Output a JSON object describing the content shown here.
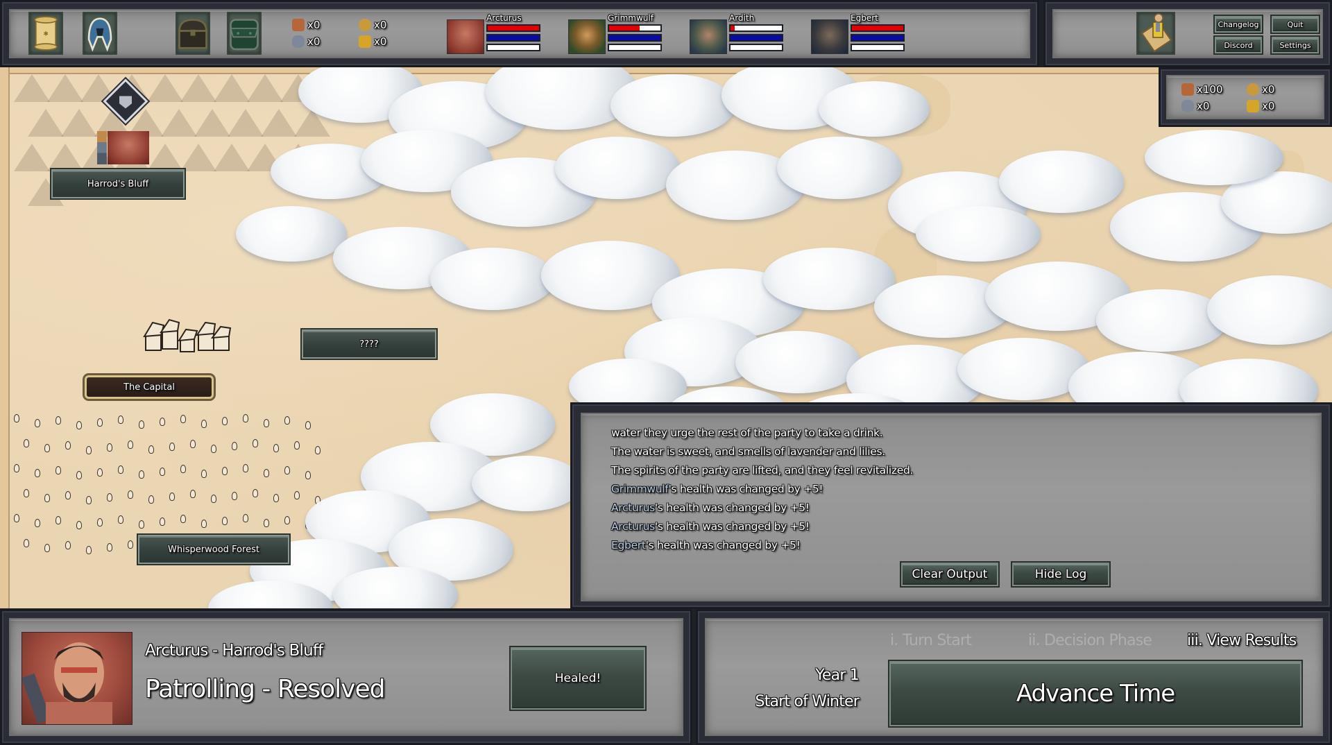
{
  "top_bar": {
    "menu_icons": [
      {
        "icon": "map-scroll-icon",
        "label": "Map"
      },
      {
        "icon": "helmet-icon",
        "label": "Heroes"
      },
      {
        "icon": "treasure-chest-icon",
        "label": "Inventory"
      },
      {
        "icon": "backpack-icon",
        "label": "Bag"
      }
    ],
    "resources": [
      {
        "icon": "wood-icon",
        "value": "x0",
        "color": "#b5673a"
      },
      {
        "icon": "coin-icon",
        "value": "x0",
        "color": "#c99a3b"
      },
      {
        "icon": "ore-icon",
        "value": "x0",
        "color": "#7f8898"
      },
      {
        "icon": "grain-icon",
        "value": "x0",
        "color": "#d6a426"
      }
    ],
    "heroes": [
      {
        "name": "Arcturus",
        "health": 1.0,
        "mana": 1.0,
        "xp": 0.0,
        "portrait_color": "#a2473a"
      },
      {
        "name": "Grimmwulf",
        "health": 0.6,
        "mana": 1.0,
        "xp": 0.0,
        "portrait_color": "#4d6b3a"
      },
      {
        "name": "Ardith",
        "health": 0.08,
        "mana": 1.0,
        "xp": 0.0,
        "portrait_color": "#3a5866"
      },
      {
        "name": "Egbert",
        "health": 1.0,
        "mana": 1.0,
        "xp": 0.0,
        "portrait_color": "#3e4656"
      }
    ],
    "bar_colors": {
      "health": "#e40000",
      "mana": "#0a0aa8",
      "xp": "#ffffff"
    }
  },
  "top_right": {
    "quest_icon": "quest-scroll-icon",
    "buttons": {
      "changelog": "Changelog",
      "quit": "Quit",
      "discord": "Discord",
      "settings": "Settings"
    }
  },
  "stockpile": {
    "resources": [
      {
        "icon": "wood-icon",
        "value": "x100",
        "color": "#b5673a"
      },
      {
        "icon": "coin-icon",
        "value": "x0",
        "color": "#c99a3b"
      },
      {
        "icon": "ore-icon",
        "value": "x0",
        "color": "#7f8898"
      },
      {
        "icon": "grain-icon",
        "value": "x0",
        "color": "#d6a426"
      }
    ]
  },
  "map": {
    "locations": {
      "harrods_bluff": "Harrod's Bluff",
      "capital": "The Capital",
      "unknown": "????",
      "whisperwood": "Whisperwood Forest"
    },
    "marker_icon": "banner-shield-icon"
  },
  "log": {
    "lines": [
      {
        "highlight": "",
        "text": "water they urge the rest of the party to take a drink."
      },
      {
        "highlight": "",
        "text": "The water is sweet, and smells of lavender and lilies."
      },
      {
        "highlight": "",
        "text": "The spirits of the party are lifted, and they feel revitalized."
      },
      {
        "highlight": "Grimmwulf",
        "text": "'s health was changed by +5!"
      },
      {
        "highlight": "Arcturus",
        "text": "'s health was changed by +5!"
      },
      {
        "highlight": "Arcturus",
        "text": "'s health was changed by +5!"
      },
      {
        "highlight": "Egbert",
        "text": "'s health was changed by +5!"
      }
    ],
    "clear_button": "Clear Output",
    "hide_button": "Hide Log"
  },
  "event_panel": {
    "title": "Arcturus - Harrod's Bluff",
    "status": "Patrolling - Resolved",
    "result_button": "Healed!"
  },
  "time_panel": {
    "phases": [
      {
        "label": "i. Turn Start",
        "active": false
      },
      {
        "label": "ii. Decision Phase",
        "active": false
      },
      {
        "label": "iii. View Results",
        "active": true
      }
    ],
    "year": "Year 1",
    "season": "Start of Winter",
    "advance_button": "Advance Time"
  }
}
